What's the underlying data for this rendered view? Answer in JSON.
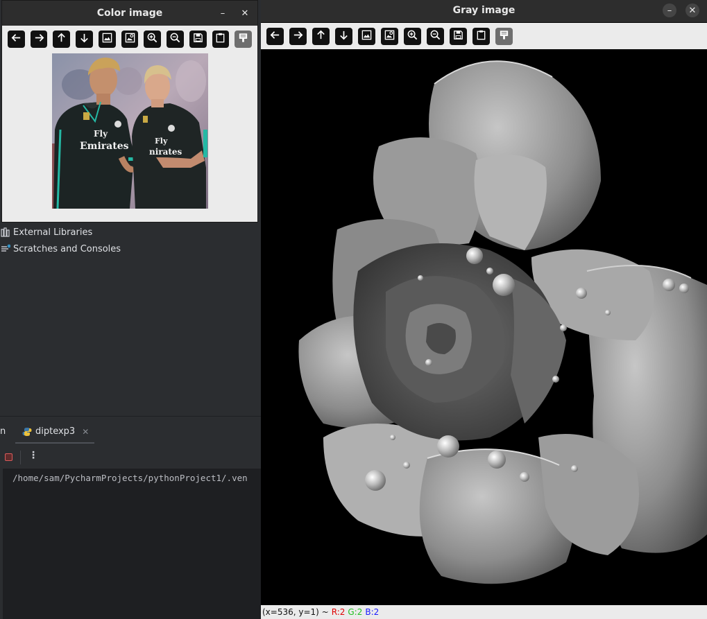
{
  "ide": {
    "tree": [
      {
        "label": "External Libraries",
        "icon": "library-icon"
      },
      {
        "label": "Scratches and Consoles",
        "icon": "scratches-icon"
      }
    ],
    "tab_partial": "n",
    "tab": {
      "label": "diptexp3",
      "icon": "python-icon"
    },
    "console_text": "/home/sam/PycharmProjects/pythonProject1/.ven"
  },
  "color_window": {
    "title": "Color image",
    "minimize": "–",
    "close": "✕",
    "image_text": [
      "Fly Emirates",
      "Fly Emirates"
    ]
  },
  "gray_window": {
    "title": "Gray image",
    "minimize": "–",
    "close": "✕",
    "status": {
      "coords": "(x=536, y=1) ~",
      "r": "R:2",
      "g": "G:2",
      "b": "B:2"
    }
  },
  "toolbar_icons": [
    "arrow-left-icon",
    "arrow-right-icon",
    "arrow-up-icon",
    "arrow-down-icon",
    "image-icon",
    "image-search-icon",
    "zoom-in-icon",
    "zoom-out-icon",
    "save-icon",
    "clipboard-icon",
    "properties-icon"
  ],
  "colors": {
    "status_r": "#e00000",
    "status_g": "#20c020",
    "status_b": "#1a1aff",
    "ide_bg": "#2b2d30",
    "titlebar": "#2d2d2d"
  }
}
